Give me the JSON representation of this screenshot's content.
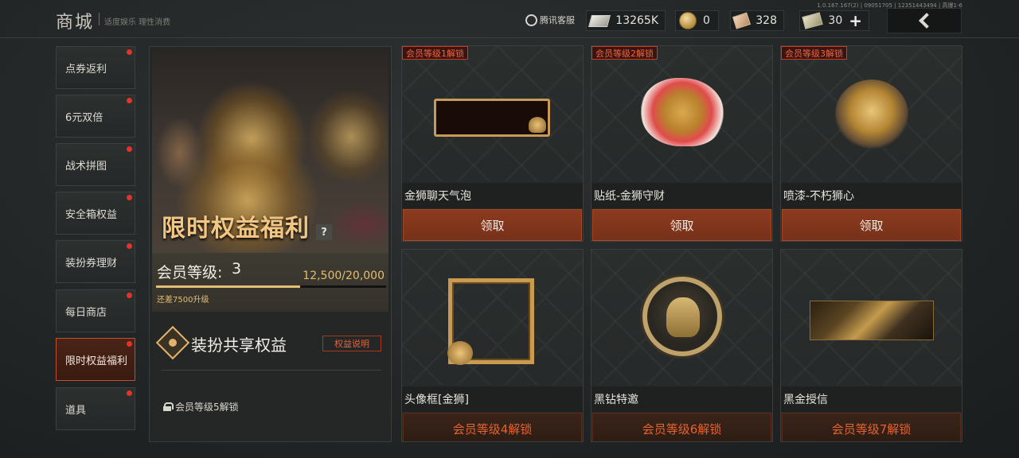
{
  "header": {
    "title": "商城",
    "slogan": "适度娱乐 理性消费",
    "customer_service": "腾讯客服",
    "version": "1.0.167.167(2) | 09051705 | 12351443494 | 高爆1-6",
    "currencies": [
      {
        "icon": "bills-icon",
        "value": "13265K"
      },
      {
        "icon": "coin-icon",
        "value": "0"
      },
      {
        "icon": "ticket-icon",
        "value": "328"
      },
      {
        "icon": "voucher-icon",
        "value": "30"
      }
    ],
    "add_label": "+"
  },
  "sidebar": {
    "items": [
      {
        "label": "点券返利",
        "active": false,
        "dot": true
      },
      {
        "label": "6元双倍",
        "active": false,
        "dot": true
      },
      {
        "label": "战术拼图",
        "active": false,
        "dot": true
      },
      {
        "label": "安全箱权益",
        "active": false,
        "dot": true
      },
      {
        "label": "装扮券理财",
        "active": false,
        "dot": true
      },
      {
        "label": "每日商店",
        "active": false,
        "dot": true
      },
      {
        "label": "限时权益福利",
        "active": true,
        "dot": true
      },
      {
        "label": "道具",
        "active": false,
        "dot": true
      }
    ]
  },
  "promo": {
    "title": "限时权益福利",
    "help": "?",
    "level_label": "会员等级:",
    "level_value": "3",
    "progress_text": "12,500/20,000",
    "progress_fraction": 0.625,
    "hint": "还差7500升级",
    "share_title": "装扮共享权益",
    "rules_button": "权益说明",
    "lock_text": "会员等级5解锁"
  },
  "rewards": [
    {
      "tag": "会员等级1解锁",
      "name": "金狮聊天气泡",
      "action": "领取",
      "claimable": true
    },
    {
      "tag": "会员等级2解锁",
      "name": "贴纸-金狮守财",
      "action": "领取",
      "claimable": true
    },
    {
      "tag": "会员等级3解锁",
      "name": "喷漆-不朽狮心",
      "action": "领取",
      "claimable": true
    },
    {
      "tag": "",
      "name": "头像框[金狮]",
      "action": "会员等级4解锁",
      "claimable": false
    },
    {
      "tag": "",
      "name": "黑钻特邀",
      "action": "会员等级6解锁",
      "claimable": false
    },
    {
      "tag": "",
      "name": "黑金授信",
      "action": "会员等级7解锁",
      "claimable": false
    }
  ],
  "colors": {
    "accent": "#c1502a",
    "gold": "#e2bf74",
    "claim": "#8b3b1e",
    "notify": "#e3332a"
  }
}
